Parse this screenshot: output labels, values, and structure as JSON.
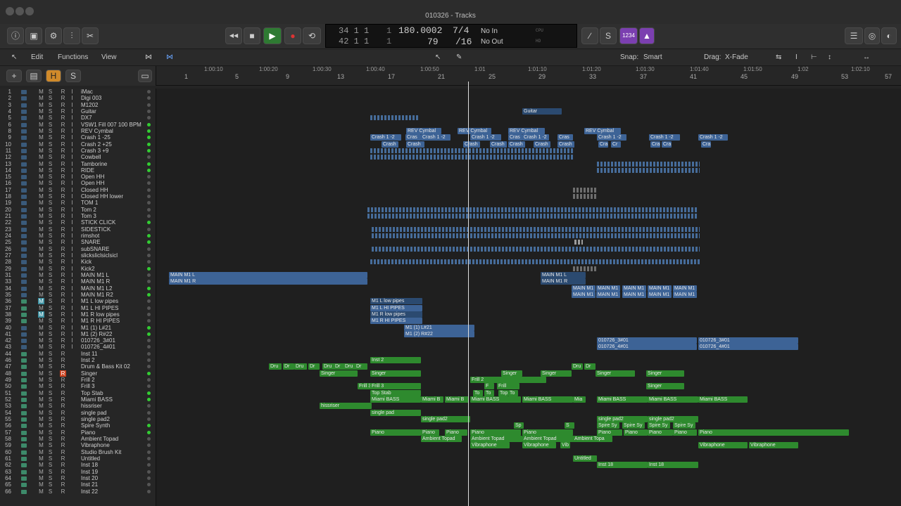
{
  "window": {
    "title": "010326 - Tracks"
  },
  "toolbar": {
    "transport": [
      "◀◀",
      "■",
      "▶",
      "●",
      "⟲"
    ],
    "lcd": {
      "bar_top": "34 1 1",
      "sub_top": "1",
      "bar_bottom": "42 1 1",
      "sub_bottom": "1",
      "tempo": "180.0002",
      "tempo_sub": "79",
      "sig": "7/4",
      "div": "/16",
      "in": "No In",
      "out": "No Out",
      "cpu": "CPU",
      "hd": "HD"
    },
    "badge": "1234"
  },
  "menubar": {
    "edit": "Edit",
    "functions": "Functions",
    "view": "View",
    "snap_label": "Snap:",
    "snap": "Smart",
    "drag_label": "Drag:",
    "drag": "X-Fade"
  },
  "header": {
    "h": "H",
    "s": "S",
    "plus": "+"
  },
  "ruler": {
    "bars": [
      "1",
      "5",
      "9",
      "13",
      "17",
      "21",
      "25",
      "29",
      "33",
      "37",
      "41",
      "45",
      "49",
      "53",
      "57"
    ],
    "times": [
      "1:00:10",
      "1:00:20",
      "1:00:30",
      "1:00:40",
      "1:00:50",
      "1:01",
      "1:01:10",
      "1:01:20",
      "1:01:30",
      "1:01:40",
      "1:01:50",
      "1:02",
      "1:02:10"
    ]
  },
  "tracks": [
    {
      "n": "1",
      "name": "iMac"
    },
    {
      "n": "2",
      "name": "Digi 003"
    },
    {
      "n": "3",
      "name": "M1202"
    },
    {
      "n": "4",
      "name": "Guitar"
    },
    {
      "n": "5",
      "name": "DX7"
    },
    {
      "n": "6",
      "name": "VSW1 Fill 007 100 BPM"
    },
    {
      "n": "8",
      "name": "REV Cymbal"
    },
    {
      "n": "9",
      "name": "Crash 1 -25"
    },
    {
      "n": "10",
      "name": "Crash 2 +25"
    },
    {
      "n": "11",
      "name": "Crash 3 +9"
    },
    {
      "n": "12",
      "name": "Cowbell"
    },
    {
      "n": "13",
      "name": "Tamborine"
    },
    {
      "n": "14",
      "name": "RIDE"
    },
    {
      "n": "15",
      "name": "Open HH"
    },
    {
      "n": "16",
      "name": "Open HH"
    },
    {
      "n": "17",
      "name": "Closed HH"
    },
    {
      "n": "18",
      "name": "Closed HH lower"
    },
    {
      "n": "19",
      "name": "TOM 1"
    },
    {
      "n": "20",
      "name": "Tom 2"
    },
    {
      "n": "21",
      "name": "Tom 3"
    },
    {
      "n": "22",
      "name": "STICK CLICK"
    },
    {
      "n": "23",
      "name": "SIDESTICK"
    },
    {
      "n": "24",
      "name": "rimshot"
    },
    {
      "n": "25",
      "name": "SNARE"
    },
    {
      "n": "26",
      "name": "subSNARE"
    },
    {
      "n": "27",
      "name": "slicksliclsiclsicl"
    },
    {
      "n": "28",
      "name": "Kick"
    },
    {
      "n": "29",
      "name": "Kick2"
    },
    {
      "n": "31",
      "name": "MAIN M1 L"
    },
    {
      "n": "33",
      "name": "MAIN M1 R"
    },
    {
      "n": "34",
      "name": "MAIN M1 L2"
    },
    {
      "n": "35",
      "name": "MAIN M1 R2"
    },
    {
      "n": "36",
      "name": "M1 L low pipes"
    },
    {
      "n": "37",
      "name": "M1 L HI PIPES"
    },
    {
      "n": "38",
      "name": "M1 R low pipes"
    },
    {
      "n": "39",
      "name": "M1 R HI PIPES"
    },
    {
      "n": "40",
      "name": "M1 (1) L#21"
    },
    {
      "n": "41",
      "name": "M1 (2) R#22"
    },
    {
      "n": "42",
      "name": "010726_3#01"
    },
    {
      "n": "43",
      "name": "010726_4#01"
    },
    {
      "n": "44",
      "name": "Inst 11"
    },
    {
      "n": "46",
      "name": "Inst 2"
    },
    {
      "n": "47",
      "name": "Drum & Bass Kit 02"
    },
    {
      "n": "48",
      "name": "Singer"
    },
    {
      "n": "49",
      "name": "Frill 2"
    },
    {
      "n": "50",
      "name": "Frill 3"
    },
    {
      "n": "51",
      "name": "Top Stab"
    },
    {
      "n": "52",
      "name": "Miami BASS"
    },
    {
      "n": "53",
      "name": "hissriser"
    },
    {
      "n": "54",
      "name": "single pad"
    },
    {
      "n": "55",
      "name": "single pad2"
    },
    {
      "n": "56",
      "name": "Spire Synth"
    },
    {
      "n": "57",
      "name": "Piano"
    },
    {
      "n": "58",
      "name": "Ambient Topad"
    },
    {
      "n": "59",
      "name": "Vibraphone"
    },
    {
      "n": "60",
      "name": "Studio Brush Kit"
    },
    {
      "n": "61",
      "name": "Untitled"
    },
    {
      "n": "62",
      "name": "Inst 18"
    },
    {
      "n": "63",
      "name": "Inst 19"
    },
    {
      "n": "64",
      "name": "Inst 20"
    },
    {
      "n": "65",
      "name": "Inst 21"
    },
    {
      "n": "66",
      "name": "Inst 22"
    }
  ],
  "track_buttons": {
    "m": "M",
    "s": "S",
    "r": "R",
    "i": "I"
  },
  "regions": [
    {
      "row": 3,
      "label": "Guitar",
      "c": "ab"
    },
    {
      "row": 6,
      "label": "REV Cymbal",
      "c": "b"
    },
    {
      "row": 6,
      "label": "REV Cymbal",
      "c": "b"
    },
    {
      "row": 6,
      "label": "REV Cymbal",
      "c": "b"
    },
    {
      "row": 6,
      "label": "REV Cymbal",
      "c": "b"
    },
    {
      "row": 7,
      "label": "Crash 1 -2",
      "c": "b"
    },
    {
      "row": 7,
      "label": "Cras",
      "c": "b"
    },
    {
      "row": 7,
      "label": "Crash 1 -2",
      "c": "b"
    },
    {
      "row": 7,
      "label": "Crash 1 -2",
      "c": "b"
    },
    {
      "row": 7,
      "label": "Cras",
      "c": "b"
    },
    {
      "row": 7,
      "label": "Crash 1 -2",
      "c": "b"
    },
    {
      "row": 7,
      "label": "Cras",
      "c": "b"
    },
    {
      "row": 7,
      "label": "Crash 1 -2",
      "c": "b"
    },
    {
      "row": 7,
      "label": "Crash 1 -2",
      "c": "b"
    },
    {
      "row": 7,
      "label": "Crash 1 -2",
      "c": "b"
    },
    {
      "row": 8,
      "label": "Crash",
      "c": "b"
    },
    {
      "row": 8,
      "label": "Crash",
      "c": "b"
    },
    {
      "row": 8,
      "label": "Crash",
      "c": "b"
    },
    {
      "row": 8,
      "label": "Crash",
      "c": "b"
    },
    {
      "row": 8,
      "label": "Crash",
      "c": "b"
    },
    {
      "row": 8,
      "label": "Crash",
      "c": "b"
    },
    {
      "row": 8,
      "label": "Crash",
      "c": "b"
    },
    {
      "row": 8,
      "label": "Cra",
      "c": "b"
    },
    {
      "row": 8,
      "label": "Cr",
      "c": "b"
    },
    {
      "row": 8,
      "label": "Cra",
      "c": "b"
    },
    {
      "row": 8,
      "label": "Cra",
      "c": "b"
    },
    {
      "row": 8,
      "label": "Cra",
      "c": "b"
    },
    {
      "row": 28,
      "label": "MAIN M1 L",
      "c": "b"
    },
    {
      "row": 29,
      "label": "MAIN M1 R",
      "c": "b"
    },
    {
      "row": 28,
      "label": "MAIN M1 L",
      "c": "ab"
    },
    {
      "row": 29,
      "label": "MAIN M1 R",
      "c": "ab"
    },
    {
      "row": 30,
      "label": "MAIN M1",
      "c": "b"
    },
    {
      "row": 30,
      "label": "MAIN M1",
      "c": "b"
    },
    {
      "row": 30,
      "label": "MAIN M1",
      "c": "b"
    },
    {
      "row": 30,
      "label": "MAIN M1",
      "c": "b"
    },
    {
      "row": 30,
      "label": "MAIN M1",
      "c": "b"
    },
    {
      "row": 31,
      "label": "MAIN M1",
      "c": "b"
    },
    {
      "row": 31,
      "label": "MAIN M1",
      "c": "b"
    },
    {
      "row": 31,
      "label": "MAIN M1",
      "c": "b"
    },
    {
      "row": 31,
      "label": "MAIN M1",
      "c": "b"
    },
    {
      "row": 31,
      "label": "MAIN M1",
      "c": "b"
    },
    {
      "row": 32,
      "label": "M1 L low pipes",
      "c": "ab"
    },
    {
      "row": 33,
      "label": "M1 L HI PIPES",
      "c": "b"
    },
    {
      "row": 34,
      "label": "M1 R low pipes",
      "c": "ab"
    },
    {
      "row": 35,
      "label": "M1 R HI PIPES",
      "c": "b"
    },
    {
      "row": 36,
      "label": "M1 (1) L#21",
      "c": "b"
    },
    {
      "row": 37,
      "label": "M1 (2) R#22",
      "c": "b"
    },
    {
      "row": 38,
      "label": "010726_3#01",
      "c": "b"
    },
    {
      "row": 38,
      "label": "010726_3#01",
      "c": "b"
    },
    {
      "row": 39,
      "label": "010726_4#01",
      "c": "b"
    },
    {
      "row": 39,
      "label": "010726_4#01",
      "c": "b"
    },
    {
      "row": 41,
      "label": "Inst 2",
      "c": "g"
    },
    {
      "row": 42,
      "label": "Dru",
      "c": "g"
    },
    {
      "row": 42,
      "label": "Dr",
      "c": "g"
    },
    {
      "row": 42,
      "label": "Dru",
      "c": "g"
    },
    {
      "row": 42,
      "label": "Dr",
      "c": "g"
    },
    {
      "row": 42,
      "label": "Dru",
      "c": "g"
    },
    {
      "row": 42,
      "label": "Dr",
      "c": "g"
    },
    {
      "row": 42,
      "label": "Dru",
      "c": "g"
    },
    {
      "row": 42,
      "label": "Dr",
      "c": "g"
    },
    {
      "row": 42,
      "label": "Dru",
      "c": "g"
    },
    {
      "row": 42,
      "label": "Dr",
      "c": "g"
    },
    {
      "row": 43,
      "label": "Singer",
      "c": "g"
    },
    {
      "row": 43,
      "label": "Singer",
      "c": "g"
    },
    {
      "row": 43,
      "label": "Singer",
      "c": "g"
    },
    {
      "row": 43,
      "label": "Singer",
      "c": "g"
    },
    {
      "row": 43,
      "label": "Singer",
      "c": "g"
    },
    {
      "row": 43,
      "label": "Singer",
      "c": "g"
    },
    {
      "row": 44,
      "label": "Frill 2",
      "c": "g"
    },
    {
      "row": 45,
      "label": "Frill 3",
      "c": "g"
    },
    {
      "row": 45,
      "label": "Frill 3",
      "c": "g"
    },
    {
      "row": 45,
      "label": "F",
      "c": "g"
    },
    {
      "row": 45,
      "label": "Frill",
      "c": "g"
    },
    {
      "row": 45,
      "label": "Singer",
      "c": "g"
    },
    {
      "row": 46,
      "label": "Top Stab",
      "c": "g"
    },
    {
      "row": 46,
      "label": "To",
      "c": "g"
    },
    {
      "row": 46,
      "label": "To",
      "c": "g"
    },
    {
      "row": 46,
      "label": "Top",
      "c": "g"
    },
    {
      "row": 46,
      "label": "To",
      "c": "g"
    },
    {
      "row": 47,
      "label": "Miami BASS",
      "c": "g"
    },
    {
      "row": 47,
      "label": "Miami B",
      "c": "g"
    },
    {
      "row": 47,
      "label": "Miami B",
      "c": "g"
    },
    {
      "row": 47,
      "label": "Miami BASS",
      "c": "g"
    },
    {
      "row": 47,
      "label": "Miami BASS",
      "c": "g"
    },
    {
      "row": 47,
      "label": "Mia",
      "c": "g"
    },
    {
      "row": 47,
      "label": "Miami BASS",
      "c": "g"
    },
    {
      "row": 47,
      "label": "Miami BASS",
      "c": "g"
    },
    {
      "row": 47,
      "label": "Miami BASS",
      "c": "g"
    },
    {
      "row": 48,
      "label": "hissriser",
      "c": "g"
    },
    {
      "row": 49,
      "label": "single pad",
      "c": "g"
    },
    {
      "row": 50,
      "label": "single pad2",
      "c": "g"
    },
    {
      "row": 50,
      "label": "single pad2",
      "c": "g"
    },
    {
      "row": 50,
      "label": "single pad2",
      "c": "g"
    },
    {
      "row": 51,
      "label": "Sp",
      "c": "g"
    },
    {
      "row": 51,
      "label": "S",
      "c": "g"
    },
    {
      "row": 51,
      "label": "Spire Sy",
      "c": "g"
    },
    {
      "row": 51,
      "label": "Spire Sy",
      "c": "g"
    },
    {
      "row": 51,
      "label": "Spire Sy",
      "c": "g"
    },
    {
      "row": 51,
      "label": "Spire Sy",
      "c": "g"
    },
    {
      "row": 52,
      "label": "Piano",
      "c": "g"
    },
    {
      "row": 52,
      "label": "Piano",
      "c": "g"
    },
    {
      "row": 52,
      "label": "Piano",
      "c": "g"
    },
    {
      "row": 52,
      "label": "Piano",
      "c": "g"
    },
    {
      "row": 52,
      "label": "Piano",
      "c": "g"
    },
    {
      "row": 52,
      "label": "Piano",
      "c": "g"
    },
    {
      "row": 52,
      "label": "Piano",
      "c": "g"
    },
    {
      "row": 52,
      "label": "Piano",
      "c": "g"
    },
    {
      "row": 52,
      "label": "Piano",
      "c": "g"
    },
    {
      "row": 52,
      "label": "Piano",
      "c": "g"
    },
    {
      "row": 53,
      "label": "Ambient Topad",
      "c": "g"
    },
    {
      "row": 53,
      "label": "Ambient Topad",
      "c": "g"
    },
    {
      "row": 53,
      "label": "Ambient Topad",
      "c": "g"
    },
    {
      "row": 53,
      "label": "Ambient Topa",
      "c": "g"
    },
    {
      "row": 54,
      "label": "Vibraphone",
      "c": "g"
    },
    {
      "row": 54,
      "label": "Vibraphone",
      "c": "g"
    },
    {
      "row": 54,
      "label": "Vib",
      "c": "g"
    },
    {
      "row": 54,
      "label": "Vibraphone",
      "c": "g"
    },
    {
      "row": 54,
      "label": "Vibraphone",
      "c": "g"
    },
    {
      "row": 56,
      "label": "Untitled",
      "c": "g"
    },
    {
      "row": 57,
      "label": "Inst 18",
      "c": "g"
    },
    {
      "row": 57,
      "label": "Inst 18",
      "c": "g"
    }
  ]
}
